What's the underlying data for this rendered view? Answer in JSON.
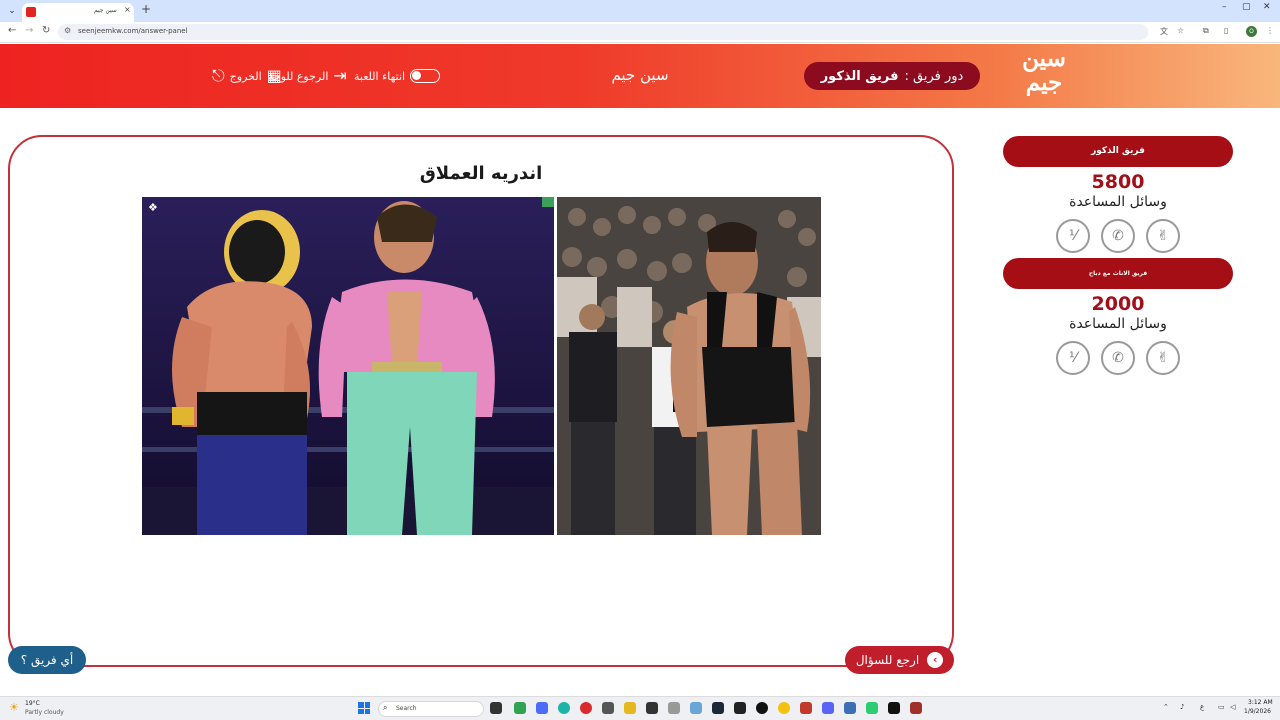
{
  "browser": {
    "tab_title": "سين جيم",
    "tab_close": "×",
    "new_tab": "+",
    "url": "seenjeemkw.com/answer-panel",
    "window_controls": [
      "–",
      "▢",
      "✕"
    ]
  },
  "header": {
    "logo_line1": "سين",
    "logo_line2": "جيم",
    "turn_label": "دور فريق :",
    "turn_team": "فريق الذكور",
    "site_name": "سين جيم",
    "end_game_label": "انتهاء اللعبة",
    "back_to_board_label": "الرجوع للوحة",
    "exit_label": "الخروج"
  },
  "answer": {
    "title": "اندريه العملاق",
    "back_to_question_label": "ارجع للسؤال",
    "which_team_label": "أي فريق ؟"
  },
  "teams": [
    {
      "name": "فريق الذكور",
      "score": "5800",
      "aids_label": "وسائل المساعدة"
    },
    {
      "name": "فريق الاناث مع دباح",
      "score": "2000",
      "aids_label": "وسائل المساعدة"
    }
  ],
  "taskbar": {
    "weather_temp": "19°C",
    "weather_desc": "Partly cloudy",
    "search_placeholder": "Search",
    "time": "3:12 AM",
    "date": "1/9/2026"
  },
  "colors": {
    "header_start": "#ee2321",
    "header_end": "#f8b77c",
    "team_pill": "#a50e14",
    "score": "#a0101a",
    "panel_border": "#c4313a",
    "back_button": "#c01e2b",
    "which_team_button": "#1f5f8b"
  }
}
